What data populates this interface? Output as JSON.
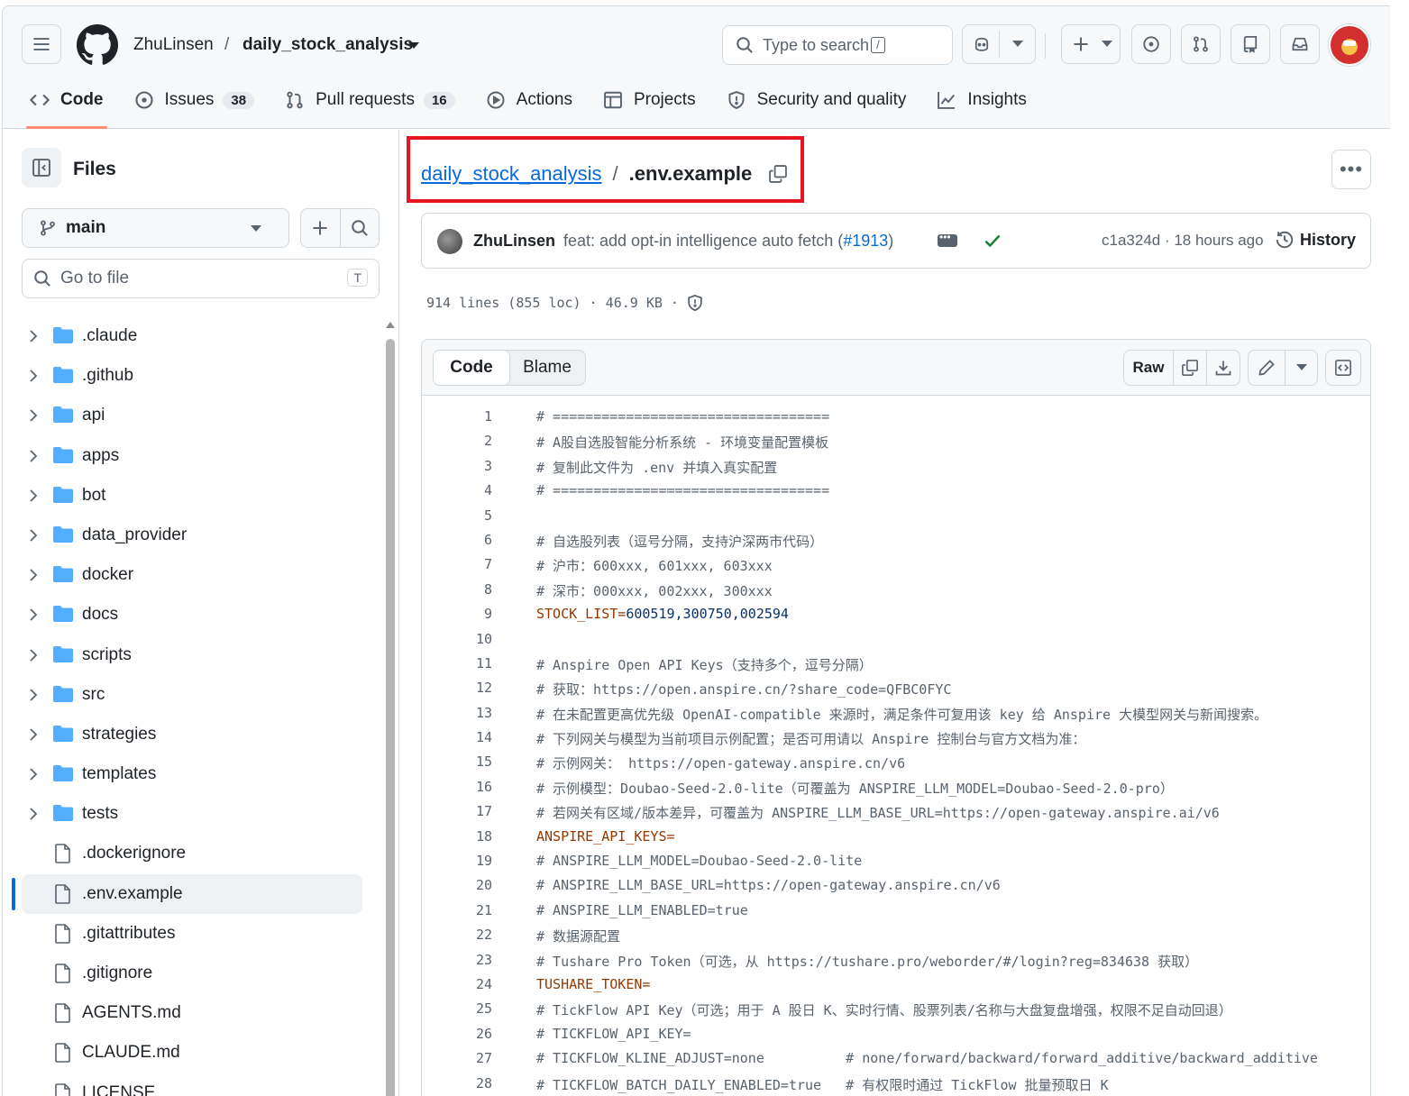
{
  "header": {
    "owner": "ZhuLinsen",
    "separator": "/",
    "repo": "daily_stock_analysis",
    "search_placeholder": "Type to search",
    "search_shortcut": "/",
    "icons": [
      "menu-icon",
      "github-logo-icon",
      "copilot-icon",
      "plus-icon",
      "issues-icon",
      "pull-requests-icon",
      "repo-icon",
      "inbox-icon"
    ]
  },
  "tabs": [
    {
      "label": "Code",
      "icon": "code-icon",
      "active": true
    },
    {
      "label": "Issues",
      "icon": "issue-icon",
      "count": "38"
    },
    {
      "label": "Pull requests",
      "icon": "pull-request-icon",
      "count": "16"
    },
    {
      "label": "Actions",
      "icon": "play-icon"
    },
    {
      "label": "Projects",
      "icon": "table-icon"
    },
    {
      "label": "Security and quality",
      "icon": "shield-icon"
    },
    {
      "label": "Insights",
      "icon": "graph-icon"
    }
  ],
  "sidebar": {
    "title": "Files",
    "branch": "main",
    "goto_placeholder": "Go to file",
    "goto_shortcut": "T",
    "items": [
      {
        "name": ".claude",
        "type": "folder"
      },
      {
        "name": ".github",
        "type": "folder"
      },
      {
        "name": "api",
        "type": "folder"
      },
      {
        "name": "apps",
        "type": "folder"
      },
      {
        "name": "bot",
        "type": "folder"
      },
      {
        "name": "data_provider",
        "type": "folder"
      },
      {
        "name": "docker",
        "type": "folder"
      },
      {
        "name": "docs",
        "type": "folder"
      },
      {
        "name": "scripts",
        "type": "folder"
      },
      {
        "name": "src",
        "type": "folder"
      },
      {
        "name": "strategies",
        "type": "folder"
      },
      {
        "name": "templates",
        "type": "folder"
      },
      {
        "name": "tests",
        "type": "folder"
      },
      {
        "name": ".dockerignore",
        "type": "file"
      },
      {
        "name": ".env.example",
        "type": "file",
        "selected": true
      },
      {
        "name": ".gitattributes",
        "type": "file"
      },
      {
        "name": ".gitignore",
        "type": "file"
      },
      {
        "name": "AGENTS.md",
        "type": "file"
      },
      {
        "name": "CLAUDE.md",
        "type": "file"
      },
      {
        "name": "LICENSE",
        "type": "file"
      }
    ]
  },
  "file": {
    "repo_link": "daily_stock_analysis",
    "separator": "/",
    "name": ".env.example",
    "commit_author": "ZhuLinsen",
    "commit_message": "feat: add opt-in intelligence auto fetch (",
    "commit_pr": "#1913",
    "commit_message_end": ")",
    "commit_sha": "c1a324d · 18 hours ago",
    "history_label": "History",
    "stats": "914 lines (855 loc) · 46.9 KB ·",
    "tab_code": "Code",
    "tab_blame": "Blame",
    "raw_label": "Raw"
  },
  "code_lines": [
    {
      "n": "1",
      "text": "# =================================="
    },
    {
      "n": "2",
      "text": "# A股自选股智能分析系统 - 环境变量配置模板"
    },
    {
      "n": "3",
      "text": "# 复制此文件为 .env 并填入真实配置"
    },
    {
      "n": "4",
      "text": "# =================================="
    },
    {
      "n": "5",
      "text": ""
    },
    {
      "n": "6",
      "text": "# 自选股列表（逗号分隔，支持沪深两市代码）"
    },
    {
      "n": "7",
      "text": "# 沪市：600xxx, 601xxx, 603xxx"
    },
    {
      "n": "8",
      "text": "# 深市：000xxx, 002xxx, 300xxx"
    },
    {
      "n": "9",
      "key": "STOCK_LIST=",
      "value": "600519,300750,002594"
    },
    {
      "n": "10",
      "text": ""
    },
    {
      "n": "11",
      "text": "# Anspire Open API Keys（支持多个，逗号分隔）"
    },
    {
      "n": "12",
      "text": "# 获取：https://open.anspire.cn/?share_code=QFBC0FYC"
    },
    {
      "n": "13",
      "text": "# 在未配置更高优先级 OpenAI-compatible 来源时，满足条件可复用该 key 给 Anspire 大模型网关与新闻搜索。"
    },
    {
      "n": "14",
      "text": "# 下列网关与模型为当前项目示例配置；是否可用请以 Anspire 控制台与官方文档为准："
    },
    {
      "n": "15",
      "text": "# 示例网关： https://open-gateway.anspire.cn/v6"
    },
    {
      "n": "16",
      "text": "# 示例模型：Doubao-Seed-2.0-lite（可覆盖为 ANSPIRE_LLM_MODEL=Doubao-Seed-2.0-pro）"
    },
    {
      "n": "17",
      "text": "# 若网关有区域/版本差异，可覆盖为 ANSPIRE_LLM_BASE_URL=https://open-gateway.anspire.ai/v6"
    },
    {
      "n": "18",
      "key": "ANSPIRE_API_KEYS=",
      "value": ""
    },
    {
      "n": "19",
      "text": "# ANSPIRE_LLM_MODEL=Doubao-Seed-2.0-lite"
    },
    {
      "n": "20",
      "text": "# ANSPIRE_LLM_BASE_URL=https://open-gateway.anspire.cn/v6"
    },
    {
      "n": "21",
      "text": "# ANSPIRE_LLM_ENABLED=true"
    },
    {
      "n": "22",
      "text": "# 数据源配置"
    },
    {
      "n": "23",
      "text": "# Tushare Pro Token（可选，从 https://tushare.pro/weborder/#/login?reg=834638 获取）"
    },
    {
      "n": "24",
      "key": "TUSHARE_TOKEN=",
      "value": ""
    },
    {
      "n": "25",
      "text": "# TickFlow API Key（可选；用于 A 股日 K、实时行情、股票列表/名称与大盘复盘增强，权限不足自动回退）"
    },
    {
      "n": "26",
      "text": "# TICKFLOW_API_KEY="
    },
    {
      "n": "27",
      "text": "# TICKFLOW_KLINE_ADJUST=none          # none/forward/backward/forward_additive/backward_additive"
    },
    {
      "n": "28",
      "text": "# TICKFLOW_BATCH_DAILY_ENABLED=true   # 有权限时通过 TickFlow 批量预取日 K"
    }
  ]
}
